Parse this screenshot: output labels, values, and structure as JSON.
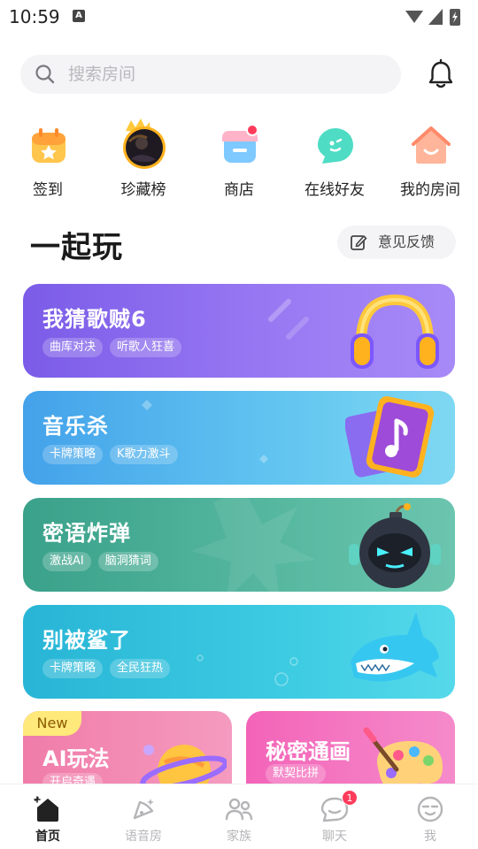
{
  "status_bar": {
    "time": "10:59",
    "notif_icon_letter": "A"
  },
  "search": {
    "placeholder": "搜索房间"
  },
  "quick_entries": [
    {
      "label": "签到",
      "icon": "checkin-calendar-icon"
    },
    {
      "label": "珍藏榜",
      "icon": "collection-rank-avatar"
    },
    {
      "label": "商店",
      "icon": "shop-icon",
      "has_dot": true
    },
    {
      "label": "在线好友",
      "icon": "online-friends-icon"
    },
    {
      "label": "我的房间",
      "icon": "my-room-icon"
    }
  ],
  "section": {
    "title": "一起玩",
    "feedback_label": "意见反馈"
  },
  "games": [
    {
      "title": "我猜歌贼6",
      "tags": [
        "曲库对决",
        "听歌人狂喜"
      ],
      "art": "headphones",
      "color": "#8a6cf0"
    },
    {
      "title": "音乐杀",
      "tags": [
        "卡牌策略",
        "K歌力激斗"
      ],
      "art": "music-card",
      "color": "#52b6ee"
    },
    {
      "title": "密语炸弹",
      "tags": [
        "激战AI",
        "脑洞猜词"
      ],
      "art": "bomb-robot",
      "color": "#4aad95"
    },
    {
      "title": "别被鲨了",
      "tags": [
        "卡牌策略",
        "全民狂热"
      ],
      "art": "shark",
      "color": "#33c1dd"
    }
  ],
  "small_games": [
    {
      "title": "AI玩法",
      "badge": "New",
      "tag": "开启奇遇",
      "art": "planet"
    },
    {
      "title": "秘密通画",
      "tag": "默契比拼",
      "art": "palette"
    }
  ],
  "bottom_nav": [
    {
      "label": "首页",
      "icon": "home-icon",
      "active": true
    },
    {
      "label": "语音房",
      "icon": "voice-room-icon",
      "active": false
    },
    {
      "label": "家族",
      "icon": "family-icon",
      "active": false
    },
    {
      "label": "聊天",
      "icon": "chat-icon",
      "active": false,
      "badge": "1"
    },
    {
      "label": "我",
      "icon": "me-icon",
      "active": false
    }
  ]
}
